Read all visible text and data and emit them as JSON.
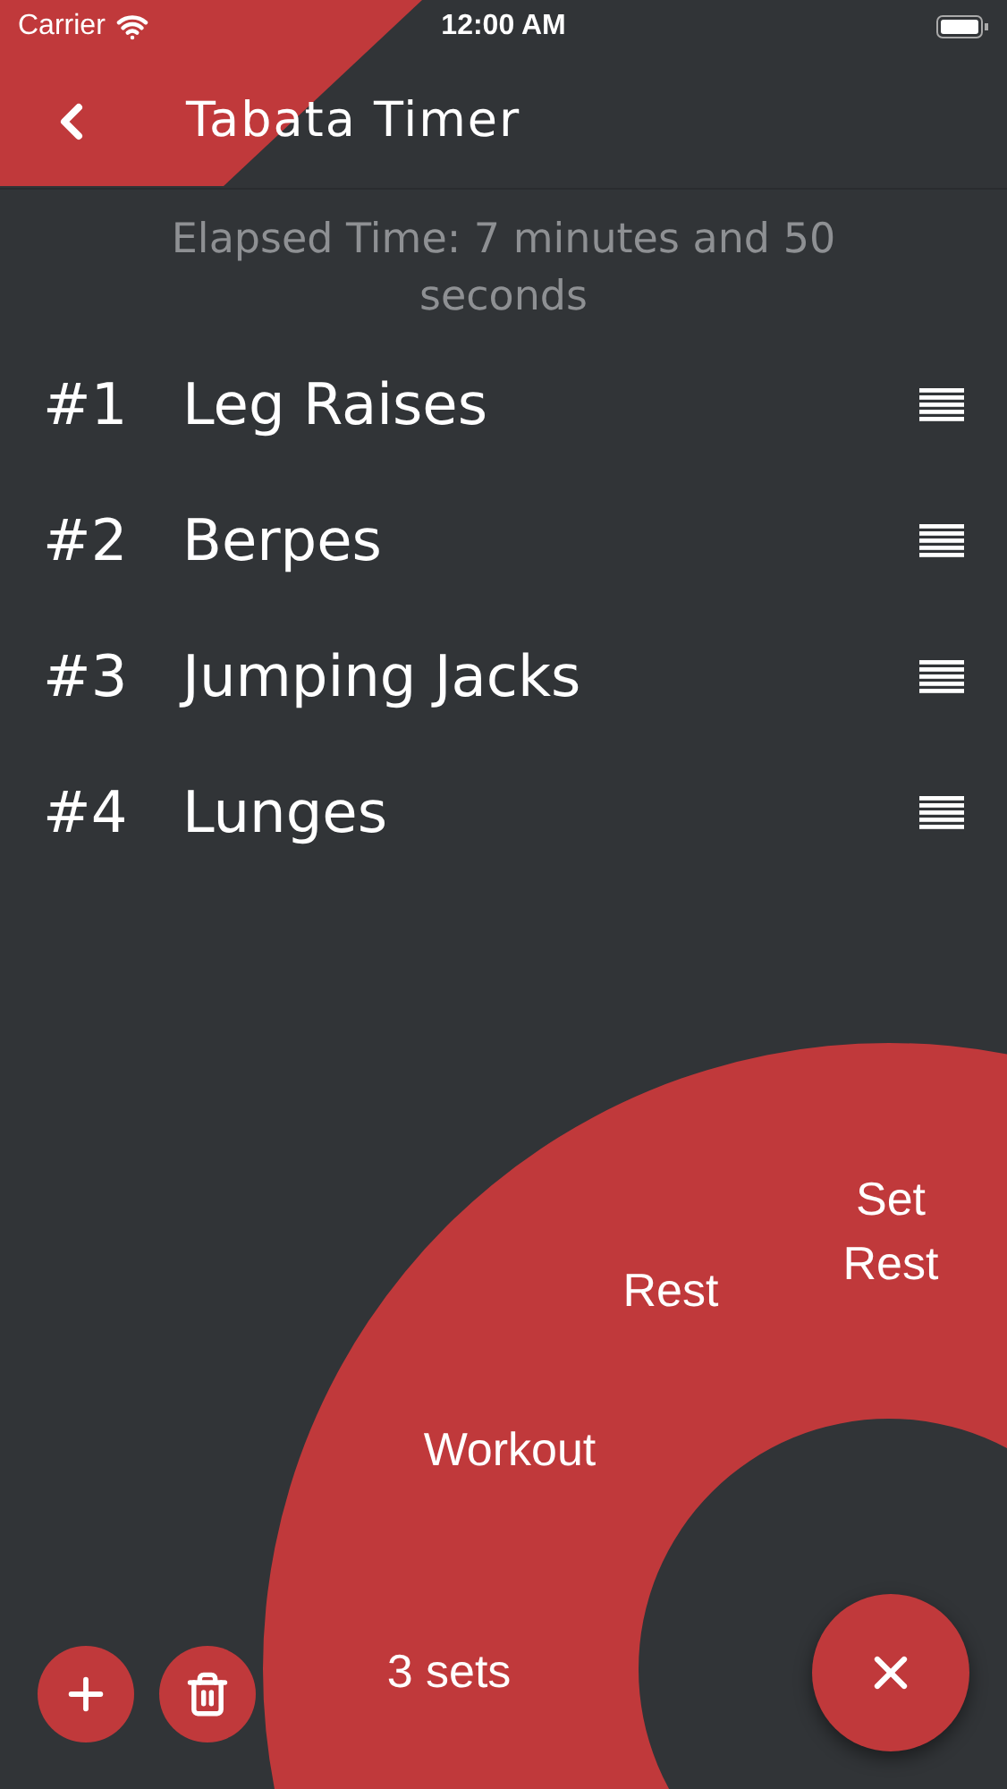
{
  "status_bar": {
    "carrier": "Carrier",
    "time": "12:00 AM"
  },
  "header": {
    "title": "Tabata Timer"
  },
  "elapsed": "Elapsed Time: 7 minutes and 50 seconds",
  "exercises": [
    {
      "number": "#1",
      "name": "Leg Raises"
    },
    {
      "number": "#2",
      "name": "Berpes"
    },
    {
      "number": "#3",
      "name": "Jumping Jacks"
    },
    {
      "number": "#4",
      "name": "Lunges"
    }
  ],
  "radial_menu": {
    "expanded": true,
    "items": [
      {
        "label": "Set Rest"
      },
      {
        "label": "Rest"
      },
      {
        "label": "Workout"
      },
      {
        "label": "3 sets"
      }
    ]
  }
}
